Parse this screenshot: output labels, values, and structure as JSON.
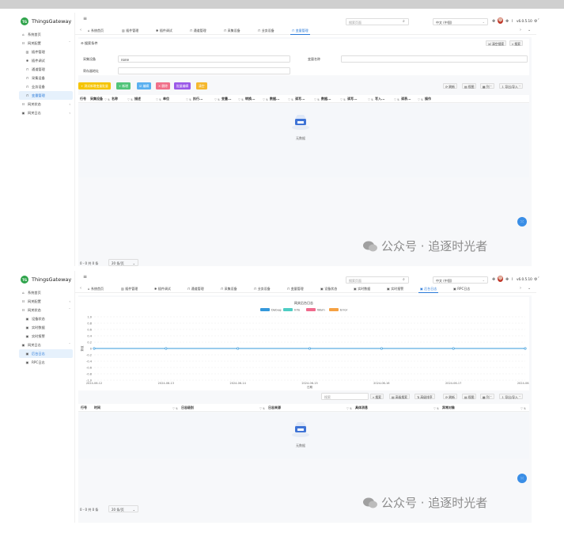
{
  "brand": {
    "logo_text": "TG",
    "name": "ThingsGateway"
  },
  "topbar": {
    "search_placeholder": "搜索页面",
    "language": "中文 (中国)",
    "version": "v6.0.5.10"
  },
  "panel1": {
    "sidebar": [
      {
        "label": "系统首页",
        "icon": "home-icon",
        "sub": false,
        "active": false,
        "chev": ""
      },
      {
        "label": "网关配置",
        "icon": "users-icon",
        "sub": false,
        "active": false,
        "chev": "ˇ"
      },
      {
        "label": "插件管理",
        "icon": "file-icon",
        "sub": true,
        "active": false,
        "chev": ""
      },
      {
        "label": "插件调试",
        "icon": "bug-icon",
        "sub": true,
        "active": false,
        "chev": ""
      },
      {
        "label": "通道管理",
        "icon": "channel-icon",
        "sub": true,
        "active": false,
        "chev": ""
      },
      {
        "label": "采集设备",
        "icon": "device-icon",
        "sub": true,
        "active": false,
        "chev": ""
      },
      {
        "label": "业务设备",
        "icon": "device-icon",
        "sub": true,
        "active": false,
        "chev": ""
      },
      {
        "label": "变量管理",
        "icon": "device-icon",
        "sub": true,
        "active": true,
        "chev": ""
      },
      {
        "label": "网关状态",
        "icon": "users-icon",
        "sub": false,
        "active": false,
        "chev": "‹"
      },
      {
        "label": "网关日志",
        "icon": "log-icon",
        "sub": false,
        "active": false,
        "chev": "‹"
      }
    ],
    "tabs": [
      {
        "label": "系统首页",
        "icon": "home-icon",
        "active": false
      },
      {
        "label": "插件管理",
        "icon": "file-icon",
        "active": false
      },
      {
        "label": "插件调试",
        "icon": "bug-icon",
        "active": false
      },
      {
        "label": "通道管理",
        "icon": "channel-icon",
        "active": false
      },
      {
        "label": "采集设备",
        "icon": "device-icon",
        "active": false
      },
      {
        "label": "业务设备",
        "icon": "device-icon",
        "active": false
      },
      {
        "label": "变量管理",
        "icon": "device-icon",
        "active": true
      }
    ],
    "search_panel": {
      "title": "搜索条件",
      "reset": "清空搜索",
      "search": "搜索",
      "f1_label": "采集设备",
      "f1_value": "none",
      "f2_label": "变量名称",
      "f3_label": "寄存器地址"
    },
    "actions": [
      {
        "label": "+ 测试新增变量批量",
        "color": "#f5c400"
      },
      {
        "label": "+ 新增",
        "color": "#52c47a"
      },
      {
        "label": "☑ 编辑",
        "color": "#5ab0f0"
      },
      {
        "label": "✕ 删除",
        "color": "#f0708a"
      },
      {
        "label": "批量编辑",
        "color": "#9b59e8"
      },
      {
        "label": "清空",
        "color": "#f5b82e"
      }
    ],
    "toolbar": {
      "refresh": "刷新",
      "view": "视图",
      "columns": "列",
      "export": "导出/导入"
    },
    "columns": [
      "行号",
      "采集设备",
      "名称",
      "描述",
      "单位",
      "执行...",
      "变量...",
      "转换...",
      "数据...",
      "读写...",
      "数据...",
      "读写...",
      "写入...",
      "读表...",
      "操作"
    ],
    "empty": "无数据",
    "pager_total": "0 - 0 共 0 条",
    "pager_size": "20 条/页"
  },
  "panel2": {
    "sidebar": [
      {
        "label": "系统首页",
        "icon": "home-icon",
        "sub": false,
        "active": false,
        "chev": ""
      },
      {
        "label": "网关配置",
        "icon": "users-icon",
        "sub": false,
        "active": false,
        "chev": "‹"
      },
      {
        "label": "网关状态",
        "icon": "users-icon",
        "sub": false,
        "active": false,
        "chev": "ˇ"
      },
      {
        "label": "设备状态",
        "icon": "log-icon",
        "sub": true,
        "active": false,
        "chev": ""
      },
      {
        "label": "实时数据",
        "icon": "log-icon",
        "sub": true,
        "active": false,
        "chev": ""
      },
      {
        "label": "实时报警",
        "icon": "log-icon",
        "sub": true,
        "active": false,
        "chev": ""
      },
      {
        "label": "网关日志",
        "icon": "log-icon",
        "sub": false,
        "active": false,
        "chev": "ˇ"
      },
      {
        "label": "后台日志",
        "icon": "log-icon",
        "sub": true,
        "active": true,
        "chev": ""
      },
      {
        "label": "RPC日志",
        "icon": "log-icon",
        "sub": true,
        "active": false,
        "chev": ""
      }
    ],
    "tabs": [
      {
        "label": "系统首页",
        "icon": "home-icon",
        "active": false
      },
      {
        "label": "插件管理",
        "icon": "file-icon",
        "active": false
      },
      {
        "label": "插件调试",
        "icon": "bug-icon",
        "active": false
      },
      {
        "label": "通道管理",
        "icon": "channel-icon",
        "active": false
      },
      {
        "label": "采集设备",
        "icon": "device-icon",
        "active": false
      },
      {
        "label": "业务设备",
        "icon": "device-icon",
        "active": false
      },
      {
        "label": "变量管理",
        "icon": "device-icon",
        "active": false
      },
      {
        "label": "设备状态",
        "icon": "log-icon",
        "active": false
      },
      {
        "label": "实时数据",
        "icon": "log-icon",
        "active": false
      },
      {
        "label": "实时报警",
        "icon": "log-icon",
        "active": false
      },
      {
        "label": "后台日志",
        "icon": "log-icon",
        "active": true
      },
      {
        "label": "RPC日志",
        "icon": "log-icon",
        "active": false
      }
    ],
    "toolbar": {
      "search_placeholder": "搜索",
      "search": "搜索",
      "adv_search": "高级搜索",
      "sort": "高级排序",
      "refresh": "刷新",
      "view": "视图",
      "columns": "列",
      "export": "导出/导入"
    },
    "columns": [
      "行号",
      "时间",
      "日志级别",
      "日志来源",
      "具体消息",
      "异常对象"
    ],
    "empty": "无数据",
    "pager_total": "0 - 0 共 0 条",
    "pager_size": "20 条/页"
  },
  "watermark": "公众号 · 追逐时光者",
  "chart_data": {
    "type": "line",
    "title": "网关后台日志",
    "xlabel": "日期",
    "ylabel": "数值",
    "x": [
      "2024-06-12",
      "2024-06-13",
      "2024-06-14",
      "2024-06-15",
      "2024-06-16",
      "2024-06-17",
      "2024-06-18"
    ],
    "ylim": [
      -1,
      1
    ],
    "yticks": [
      "1.0",
      "0.8",
      "0.6",
      "0.4",
      "0.2",
      "0",
      "-0.2",
      "-0.4",
      "-0.6",
      "-0.8",
      "-1.0"
    ],
    "series": [
      {
        "name": "Debug",
        "color": "#3498db",
        "values": [
          0,
          0,
          0,
          0,
          0,
          0,
          0
        ]
      },
      {
        "name": "Info",
        "color": "#4ecdc4",
        "values": [
          0,
          0,
          0,
          0,
          0,
          0,
          0
        ]
      },
      {
        "name": "Warn",
        "color": "#f06a8c",
        "values": [
          0,
          0,
          0,
          0,
          0,
          0,
          0
        ]
      },
      {
        "name": "Error",
        "color": "#f5a142",
        "values": [
          0,
          0,
          0,
          0,
          0,
          0,
          0
        ]
      }
    ],
    "legend": "top",
    "grid": true
  }
}
